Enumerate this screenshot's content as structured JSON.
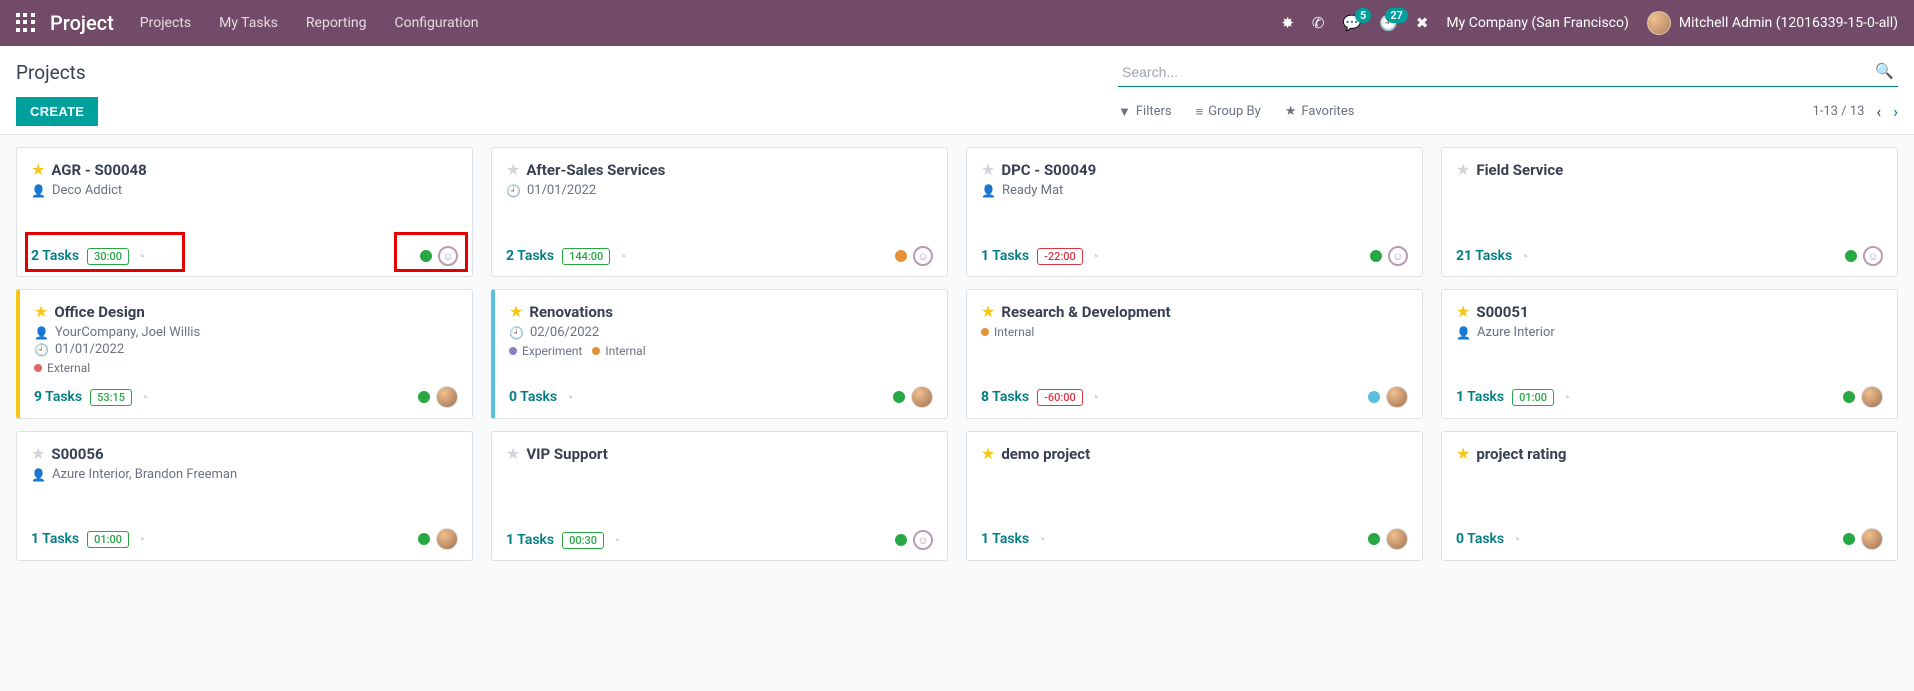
{
  "navbar": {
    "brand": "Project",
    "links": [
      "Projects",
      "My Tasks",
      "Reporting",
      "Configuration"
    ],
    "badges": {
      "messages": "5",
      "activities": "27"
    },
    "company": "My Company (San Francisco)",
    "user": "Mitchell Admin (12016339-15-0-all)"
  },
  "control": {
    "breadcrumb": "Projects",
    "create": "CREATE",
    "search_placeholder": "Search...",
    "filters": "Filters",
    "groupby": "Group By",
    "favorites": "Favorites",
    "pager": "1-13 / 13"
  },
  "cards": [
    {
      "star": true,
      "title": "AGR - S00048",
      "metas": [
        {
          "icon": "person",
          "text": "Deco Addict"
        }
      ],
      "tags": [],
      "tasks": "2",
      "hours": "30:00",
      "hours_red": false,
      "status": "green",
      "right": "face"
    },
    {
      "star": false,
      "title": "After-Sales Services",
      "metas": [
        {
          "icon": "clock",
          "text": "01/01/2022"
        }
      ],
      "tags": [],
      "tasks": "2",
      "hours": "144:00",
      "hours_red": false,
      "status": "orange",
      "right": "face"
    },
    {
      "star": false,
      "title": "DPC - S00049",
      "metas": [
        {
          "icon": "person",
          "text": "Ready Mat"
        }
      ],
      "tags": [],
      "tasks": "1",
      "hours": "-22:00",
      "hours_red": true,
      "status": "green",
      "right": "face"
    },
    {
      "star": false,
      "title": "Field Service",
      "metas": [],
      "tags": [],
      "tasks": "21",
      "hours": null,
      "status": "green",
      "right": "face"
    },
    {
      "star": true,
      "title": "Office Design",
      "bar": "yellow",
      "metas": [
        {
          "icon": "person",
          "text": "YourCompany, Joel Willis"
        },
        {
          "icon": "clock",
          "text": "01/01/2022"
        }
      ],
      "tags": [
        {
          "color": "red",
          "label": "External"
        }
      ],
      "tasks": "9",
      "hours": "53:15",
      "hours_red": false,
      "status": "green",
      "right": "avatar"
    },
    {
      "star": true,
      "title": "Renovations",
      "bar": "blue",
      "metas": [
        {
          "icon": "clock",
          "text": "02/06/2022"
        }
      ],
      "tags": [
        {
          "color": "purple",
          "label": "Experiment"
        },
        {
          "color": "orange",
          "label": "Internal"
        }
      ],
      "tasks": "0",
      "hours": null,
      "status": "green",
      "right": "avatar"
    },
    {
      "star": true,
      "title": "Research & Development",
      "metas": [],
      "tags": [
        {
          "color": "orange",
          "label": "Internal"
        }
      ],
      "tasks": "8",
      "hours": "-60:00",
      "hours_red": true,
      "status": "blue",
      "right": "avatar"
    },
    {
      "star": true,
      "title": "S00051",
      "metas": [
        {
          "icon": "person",
          "text": "Azure Interior"
        }
      ],
      "tags": [],
      "tasks": "1",
      "hours": "01:00",
      "hours_red": false,
      "status": "green",
      "right": "avatar"
    },
    {
      "star": false,
      "title": "S00056",
      "metas": [
        {
          "icon": "person",
          "text": "Azure Interior, Brandon Freeman"
        }
      ],
      "tags": [],
      "tasks": "1",
      "hours": "01:00",
      "hours_red": false,
      "status": "green",
      "right": "avatar"
    },
    {
      "star": false,
      "title": "VIP Support",
      "metas": [],
      "tags": [],
      "tasks": "1",
      "hours": "00:30",
      "hours_red": false,
      "status": "green",
      "right": "face"
    },
    {
      "star": true,
      "title": "demo project",
      "metas": [],
      "tags": [],
      "tasks": "1",
      "hours": null,
      "status": "green",
      "right": "avatar"
    },
    {
      "star": true,
      "title": "project rating",
      "metas": [],
      "tags": [],
      "tasks": "0",
      "hours": null,
      "status": "green",
      "right": "avatar"
    }
  ]
}
